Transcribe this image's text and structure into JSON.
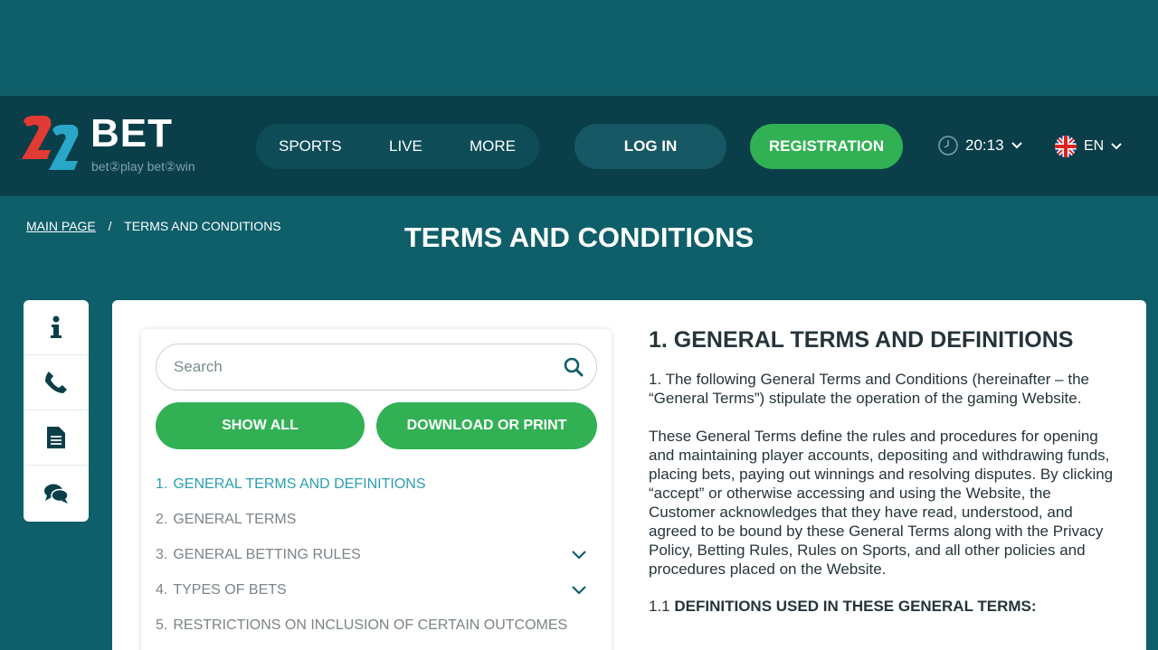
{
  "header": {
    "logo_brand": "BET",
    "logo_tagline": "bet②play  bet②win",
    "nav": [
      "SPORTS",
      "LIVE",
      "MORE"
    ],
    "login_label": "LOG IN",
    "register_label": "REGISTRATION",
    "time": "20:13",
    "language": "EN"
  },
  "breadcrumb": {
    "home": "MAIN PAGE",
    "separator": "/",
    "current": "TERMS AND CONDITIONS"
  },
  "page_title": "TERMS AND CONDITIONS",
  "toc": {
    "search_placeholder": "Search",
    "show_all_label": "SHOW ALL",
    "download_label": "DOWNLOAD OR PRINT",
    "items": [
      {
        "num": "1.",
        "label": "GENERAL TERMS AND DEFINITIONS",
        "active": true,
        "expandable": false
      },
      {
        "num": "2.",
        "label": "GENERAL TERMS",
        "active": false,
        "expandable": false
      },
      {
        "num": "3.",
        "label": "GENERAL BETTING RULES",
        "active": false,
        "expandable": true
      },
      {
        "num": "4.",
        "label": "TYPES OF BETS",
        "active": false,
        "expandable": true
      },
      {
        "num": "5.",
        "label": "RESTRICTIONS ON INCLUSION OF CERTAIN OUTCOMES",
        "active": false,
        "expandable": false
      }
    ]
  },
  "article": {
    "heading": "1. GENERAL TERMS AND DEFINITIONS",
    "paragraphs": [
      "1. The following General Terms and Conditions (hereinafter – the “General Terms”) stipulate the operation of the gaming Website.",
      "These General Terms define the rules and procedures for opening and maintaining player accounts, depositing and withdrawing funds, placing bets, paying out winnings and resolving disputes. By clicking “accept” or otherwise accessing and using the Website, the Customer acknowledges that they have read, understood, and agreed to be bound by these General Terms along with the Privacy Policy, Betting Rules, Rules on Sports, and all other policies and procedures placed on the Website."
    ],
    "def_num": "1.1",
    "def_title": "DEFINITIONS USED IN THESE GENERAL TERMS:"
  },
  "sidebar_icons": [
    "info-icon",
    "phone-icon",
    "document-icon",
    "chat-icon"
  ],
  "colors": {
    "background": "#0e5f6a",
    "header": "#0a3f49",
    "accent_green": "#31b154",
    "active_link": "#2a9fb0"
  }
}
